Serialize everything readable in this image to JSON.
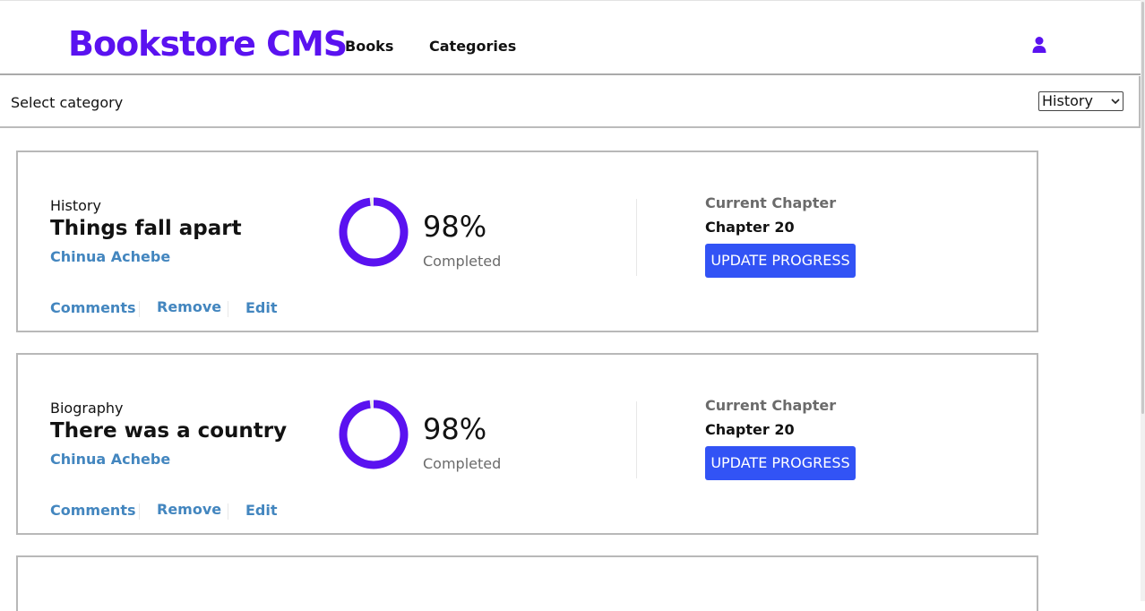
{
  "header": {
    "logo": "Bookstore CMS",
    "nav": {
      "books": "Books",
      "categories": "Categories"
    },
    "user_icon": "user-icon"
  },
  "filter": {
    "label": "Select category",
    "selected": "History"
  },
  "book_labels": {
    "comments": "Comments",
    "remove": "Remove",
    "edit": "Edit",
    "completed": "Completed",
    "current_chapter": "Current Chapter",
    "update_button": "UPDATE PROGRESS"
  },
  "books": [
    {
      "genre": "History",
      "title": "Things fall apart",
      "author": "Chinua Achebe",
      "progress_percent": "98%",
      "progress_fraction": 0.98,
      "chapter": "Chapter 20"
    },
    {
      "genre": "Biography",
      "title": "There was a country",
      "author": "Chinua Achebe",
      "progress_percent": "98%",
      "progress_fraction": 0.98,
      "chapter": "Chapter 20"
    }
  ],
  "colors": {
    "brand": "#5a12f0",
    "accent_link": "#4386bf",
    "button": "#3253f5",
    "progress_ring": "#5a12f0"
  }
}
